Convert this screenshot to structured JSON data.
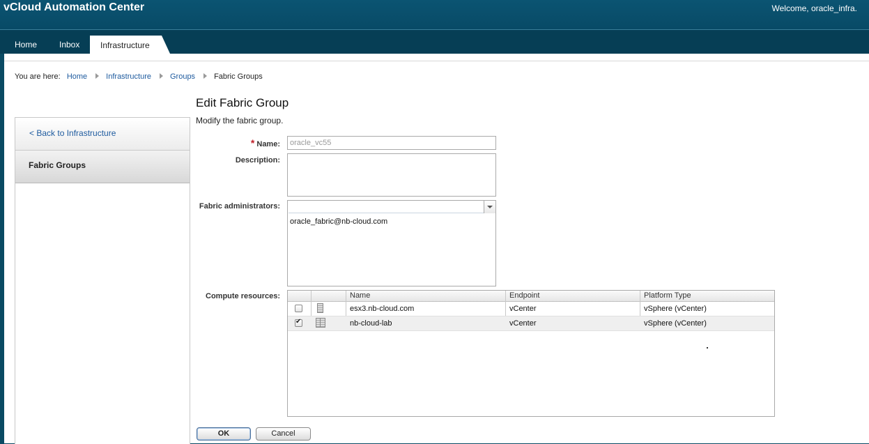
{
  "header": {
    "app_title": "vCloud Automation Center",
    "welcome": "Welcome, oracle_infra."
  },
  "tabs": [
    {
      "label": "Home"
    },
    {
      "label": "Inbox"
    },
    {
      "label": "Infrastructure",
      "active": true
    }
  ],
  "breadcrumb": {
    "prefix": "You are here:",
    "items": [
      "Home",
      "Infrastructure",
      "Groups",
      "Fabric Groups"
    ]
  },
  "sidebar": {
    "back_link": "< Back to Infrastructure",
    "items": [
      {
        "label": "Fabric Groups",
        "selected": true
      }
    ]
  },
  "form": {
    "title": "Edit Fabric Group",
    "subtitle": "Modify the fabric group.",
    "name_label": "Name:",
    "name_value": "oracle_vc55",
    "description_label": "Description:",
    "description_value": "",
    "admins_label": "Fabric administrators:",
    "admins": [
      "oracle_fabric@nb-cloud.com"
    ],
    "compute_label": "Compute resources:"
  },
  "grid": {
    "columns": [
      "Name",
      "Endpoint",
      "Platform Type"
    ],
    "rows": [
      {
        "checked": false,
        "icon": "host-server-icon",
        "name": "esx3.nb-cloud.com",
        "endpoint": "vCenter",
        "platform": "vSphere (vCenter)"
      },
      {
        "checked": true,
        "icon": "cluster-server-icon",
        "name": "nb-cloud-lab",
        "endpoint": "vCenter",
        "platform": "vSphere (vCenter)"
      }
    ]
  },
  "buttons": {
    "ok": "OK",
    "cancel": "Cancel"
  },
  "colors": {
    "header_bg": "#0a4a63",
    "link": "#1d5a9e",
    "required": "#c0202a"
  }
}
